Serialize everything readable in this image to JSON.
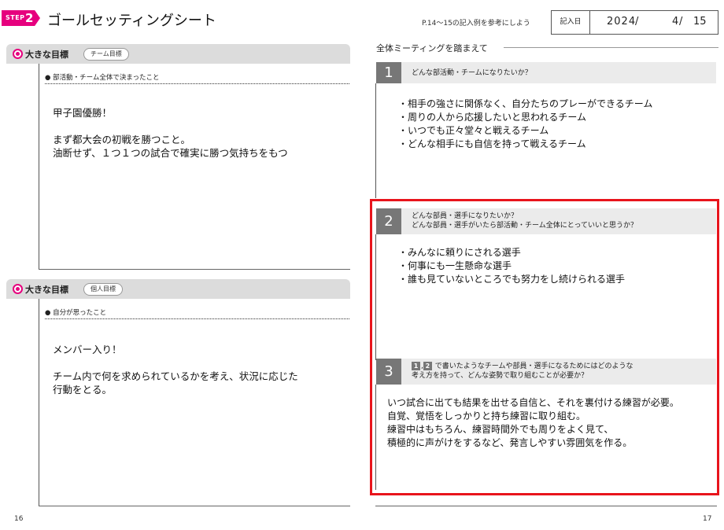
{
  "header": {
    "step_label": "STEP",
    "step_number": "2",
    "title": "ゴールセッティングシート",
    "reference": "P.14〜15の記入例を参考にしよう",
    "date_label": "記入日",
    "year": "2024",
    "month": "4",
    "day": "15",
    "date_sep": "/"
  },
  "left": {
    "team_goal": {
      "title": "大きな目標",
      "tag": "チーム目標",
      "prompt": "● 部活動・チーム全体で決まったこと",
      "text": "甲子園優勝！\n\nまず都大会の初戦を勝つこと。\n油断せず、１つ１つの試合で確実に勝つ気持ちをもつ"
    },
    "personal_goal": {
      "title": "大きな目標",
      "tag": "個人目標",
      "prompt": "● 自分が思ったこと",
      "text": "メンバー入り！\n\nチーム内で何を求められているかを考え、状況に応じた\n行動をとる。"
    },
    "page_number": "16"
  },
  "right": {
    "section_title": "全体ミーティングを踏まえて",
    "q1": {
      "number": "1",
      "question": "どんな部活動・チームになりたいか？",
      "answers": [
        "・相手の強さに関係なく、自分たちのプレーができるチーム",
        "・周りの人から応援したいと思われるチーム",
        "・いつでも正々堂々と戦えるチーム",
        "・どんな相手にも自信を持って戦えるチーム"
      ]
    },
    "q2": {
      "number": "2",
      "question_line1": "どんな部員・選手になりたいか？",
      "question_line2": "どんな部員・選手がいたら部活動・チーム全体にとっていいと思うか？",
      "answers": [
        "・みんなに頼りにされる選手",
        "・何事にも一生懸命な選手",
        "・誰も見ていないところでも努力をし続けられる選手"
      ]
    },
    "q3": {
      "number": "3",
      "ref1": "1",
      "ref_sep": ",",
      "ref2": "2",
      "question_line1": "で書いたようなチームや部員・選手になるためにはどのような",
      "question_line2": "考え方を持って、どんな姿勢で取り組むことが必要か？",
      "answers": [
        "いつ試合に出ても結果を出せる自信と、それを裏付ける練習が必要。",
        "自覚、覚悟をしっかりと持ち練習に取り組む。",
        "練習中はもちろん、練習時間外でも周りをよく見て、",
        "積極的に声がけをするなど、発言しやすい雰囲気を作る。"
      ]
    },
    "page_number": "17"
  },
  "colors": {
    "accent": "#e6007e",
    "highlight_frame": "#e8141c",
    "number_block": "#777777",
    "panel_header": "#dcdcdc"
  }
}
